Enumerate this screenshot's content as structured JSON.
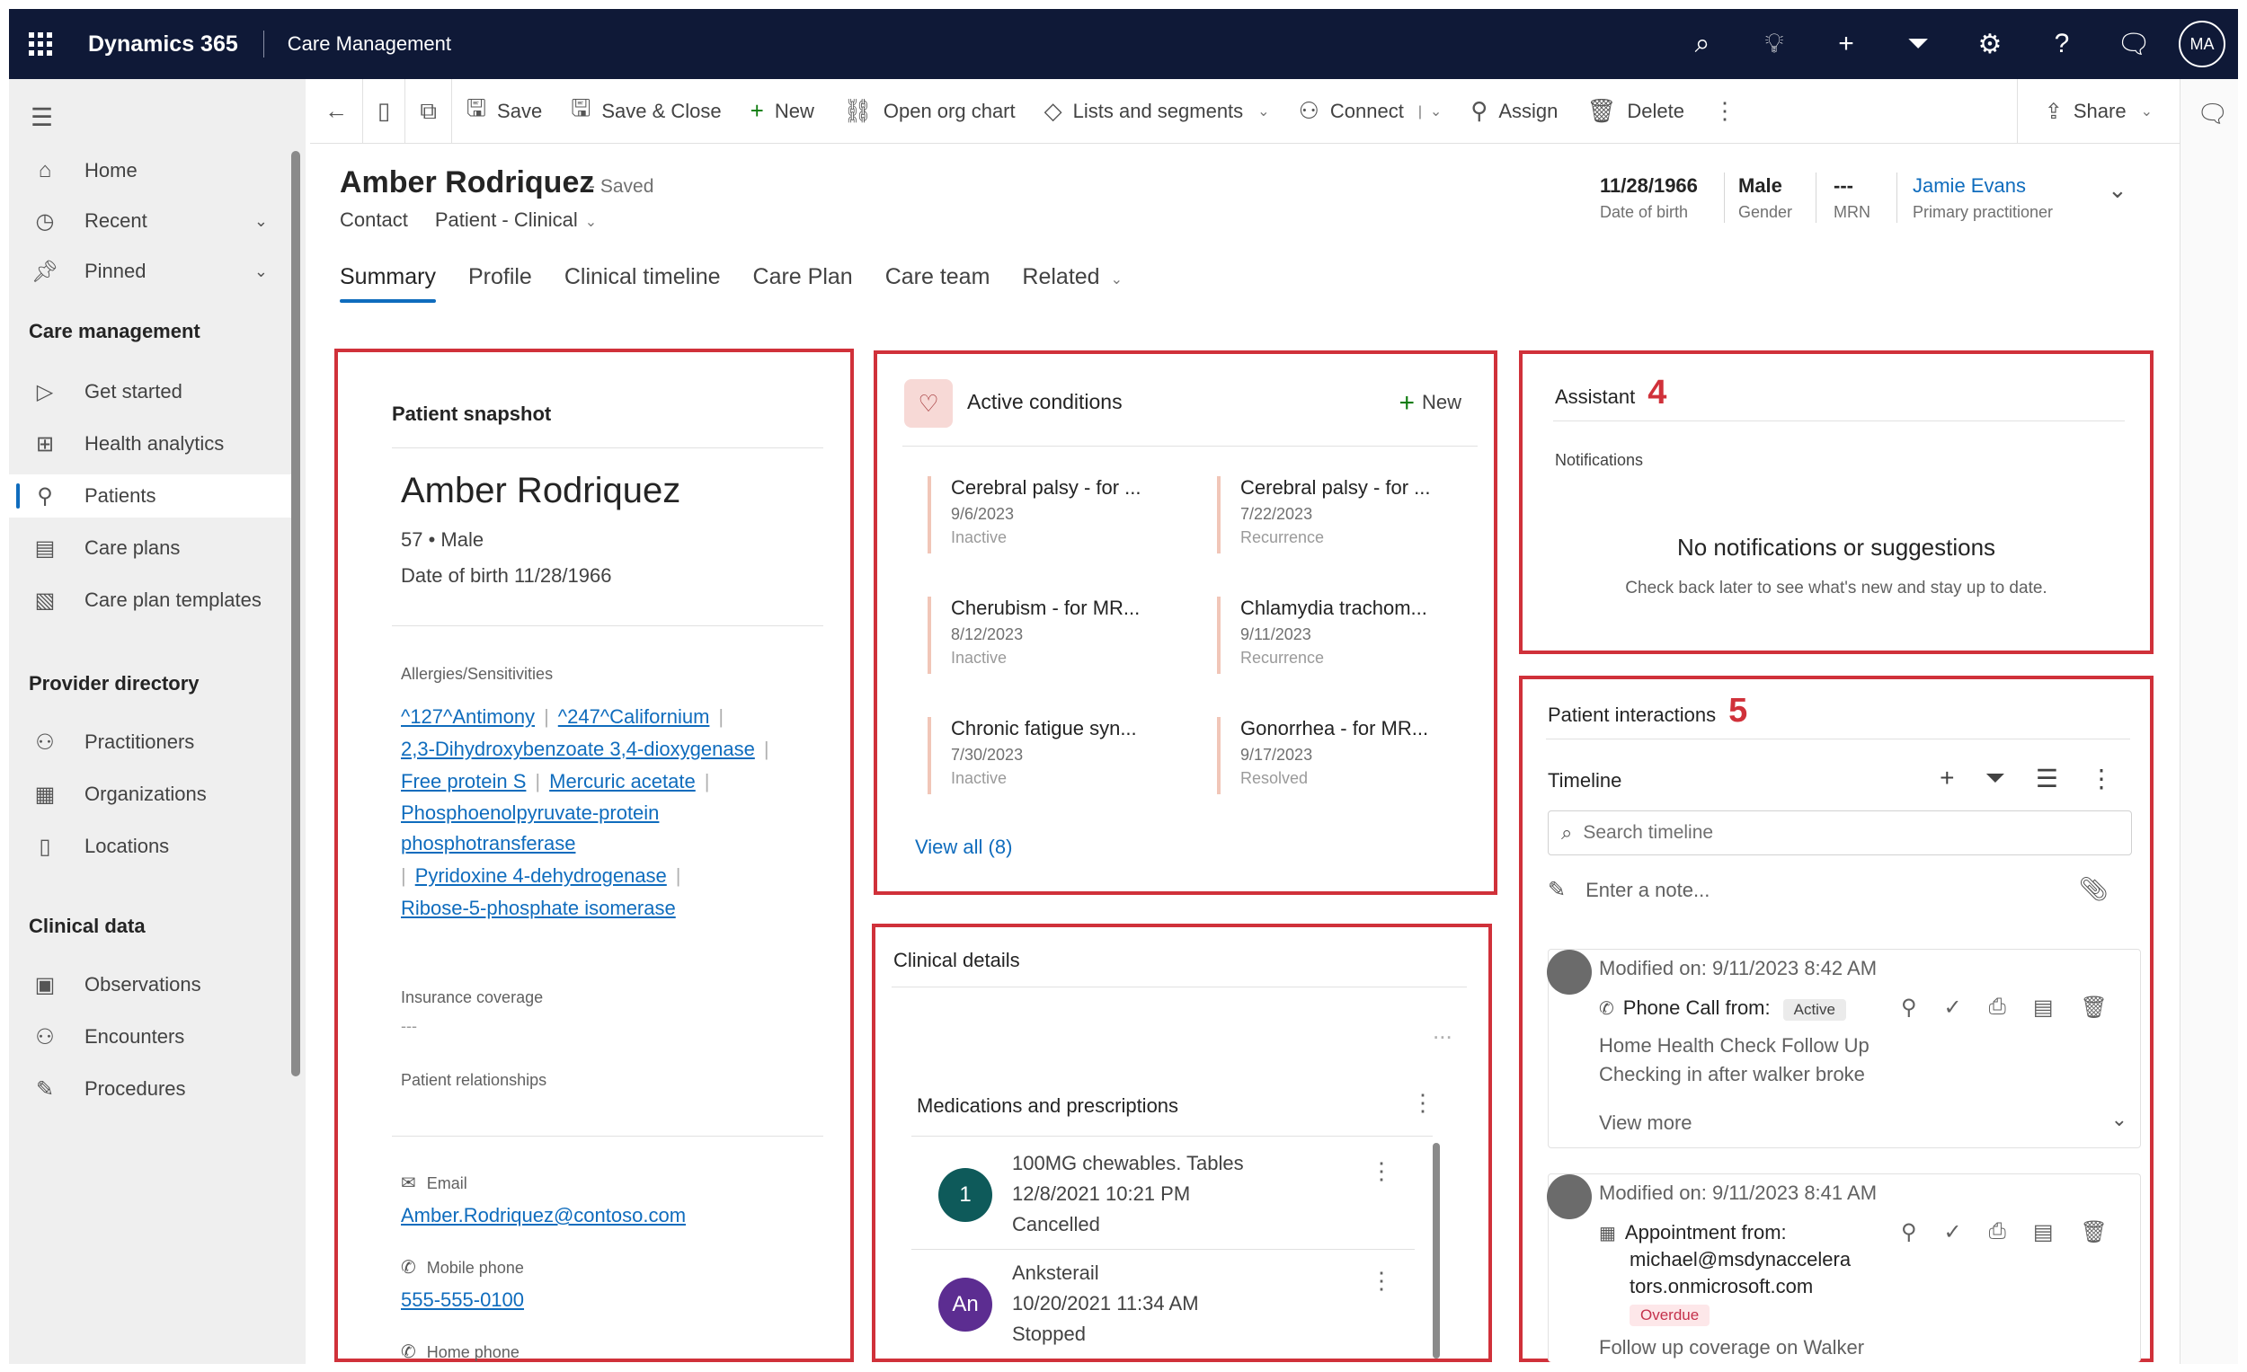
{
  "topbar": {
    "app_name": "Dynamics 365",
    "module_name": "Care Management",
    "avatar_initials": "MA",
    "icons": [
      "search-icon",
      "lightbulb-icon",
      "plus-icon",
      "filter-icon",
      "gear-icon",
      "help-icon",
      "chat-icon"
    ]
  },
  "nav": {
    "items": [
      {
        "label": "Home",
        "icon": "home-icon"
      },
      {
        "label": "Recent",
        "icon": "clock-icon"
      },
      {
        "label": "Pinned",
        "icon": "pin-icon"
      }
    ],
    "sections": [
      {
        "title": "Care management",
        "items": [
          "Get started",
          "Health analytics",
          "Patients",
          "Care plans",
          "Care plan templates"
        ]
      },
      {
        "title": "Provider directory",
        "items": [
          "Practitioners",
          "Organizations",
          "Locations"
        ]
      },
      {
        "title": "Clinical data",
        "items": [
          "Observations",
          "Encounters",
          "Procedures"
        ]
      }
    ],
    "active_item": "Patients"
  },
  "commands": [
    "Save",
    "Save & Close",
    "New",
    "Open org chart",
    "Lists and segments",
    "Connect",
    "Assign",
    "Delete",
    "Share"
  ],
  "record": {
    "name": "Amber Rodriquez",
    "status": "- Saved",
    "entity": "Contact",
    "form": "Patient - Clinical",
    "dob": "11/28/1966",
    "dob_label": "Date of birth",
    "gender": "Male",
    "gender_label": "Gender",
    "mrn": "---",
    "mrn_label": "MRN",
    "practitioner": "Jamie Evans",
    "practitioner_label": "Primary practitioner"
  },
  "tabs": [
    "Summary",
    "Profile",
    "Clinical timeline",
    "Care Plan",
    "Care team",
    "Related"
  ],
  "snapshot": {
    "title": "Patient snapshot",
    "name": "Amber Rodriquez",
    "age_gender": "57 • Male",
    "dob_line": "Date of birth 11/28/1966",
    "allergies_label": "Allergies/Sensitivities",
    "allergies": [
      "^127^Antimony",
      "^247^Californium",
      "2,3-Dihydroxybenzoate 3,4-dioxygenase",
      "Free protein S",
      "Mercuric acetate",
      "Phosphoenolpyruvate-protein phosphotransferase",
      "Pyridoxine 4-dehydrogenase",
      "Ribose-5-phosphate isomerase"
    ],
    "insurance_label": "Insurance coverage",
    "insurance_value": "---",
    "relationships_label": "Patient relationships",
    "email_label": "Email",
    "email": "Amber.Rodriquez@contoso.com",
    "mobile_label": "Mobile phone",
    "mobile": "555-555-0100",
    "home_label": "Home phone"
  },
  "conditions": {
    "title": "Active conditions",
    "new_label": "New",
    "items": [
      {
        "title": "Cerebral palsy - for ...",
        "date": "9/6/2023",
        "status": "Inactive"
      },
      {
        "title": "Cerebral palsy - for ...",
        "date": "7/22/2023",
        "status": "Recurrence"
      },
      {
        "title": "Cherubism - for MR...",
        "date": "8/12/2023",
        "status": "Inactive"
      },
      {
        "title": "Chlamydia trachom...",
        "date": "9/11/2023",
        "status": "Recurrence"
      },
      {
        "title": "Chronic fatigue syn...",
        "date": "7/30/2023",
        "status": "Inactive"
      },
      {
        "title": "Gonorrhea - for MR...",
        "date": "9/17/2023",
        "status": "Resolved"
      }
    ],
    "view_all": "View all (8)"
  },
  "assistant": {
    "title": "Assistant",
    "annotation": "4",
    "notifications_label": "Notifications",
    "empty_title": "No notifications or suggestions",
    "empty_sub": "Check back later to see what's new and stay up to date."
  },
  "clinical": {
    "title": "Clinical details",
    "more": "...",
    "meds_title": "Medications and prescriptions",
    "meds": [
      {
        "initials": "1",
        "color": "#0e5a5a",
        "name": "100MG chewables. Tables",
        "date": "12/8/2021 10:21 PM",
        "status": "Cancelled"
      },
      {
        "initials": "An",
        "color": "#5c2d91",
        "name": "Anksterail",
        "date": "10/20/2021 11:34 AM",
        "status": "Stopped"
      }
    ]
  },
  "interactions": {
    "title": "Patient interactions",
    "annotation": "5",
    "timeline_label": "Timeline",
    "search_placeholder": "Search timeline",
    "note_placeholder": "Enter a note...",
    "items": [
      {
        "modified": "Modified on: 9/11/2023 8:42 AM",
        "type": "Phone Call from:",
        "badge": "Active",
        "line1": "Home Health Check Follow Up",
        "line2": "Checking in after walker broke",
        "view_more": "View more"
      },
      {
        "modified": "Modified on: 9/11/2023 8:41 AM",
        "type": "Appointment from:",
        "email1": "michael@msdynaccelera",
        "email2": "tors.onmicrosoft.com",
        "badge": "Overdue",
        "line1": "Follow up coverage on Walker"
      }
    ]
  },
  "colors": {
    "topbar": "#0f1937",
    "accent": "#0f6cbd",
    "annotation_border": "#d0313a"
  }
}
